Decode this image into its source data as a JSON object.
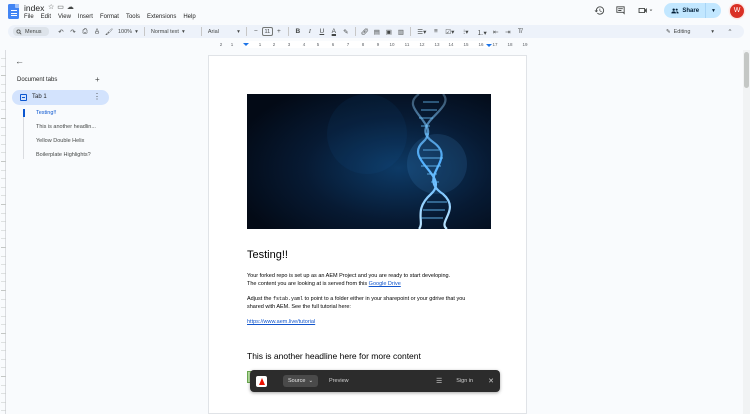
{
  "app": {
    "doc_title": "index",
    "menu": [
      "File",
      "Edit",
      "View",
      "Insert",
      "Format",
      "Tools",
      "Extensions",
      "Help"
    ]
  },
  "header": {
    "share_label": "Share",
    "avatar_letter": "W"
  },
  "toolbar": {
    "menus_label": "Menus",
    "zoom": "100%",
    "style": "Normal text",
    "font": "Arial",
    "font_size": "11",
    "mode": "Editing"
  },
  "ruler": {
    "ticks": [
      "2",
      "1",
      "1",
      "2",
      "3",
      "4",
      "5",
      "6",
      "7",
      "8",
      "9",
      "10",
      "11",
      "12",
      "13",
      "14",
      "15",
      "16",
      "17",
      "18",
      "19"
    ]
  },
  "sidebar": {
    "header": "Document tabs",
    "tab_label": "Tab 1",
    "outline": [
      "Testing!!",
      "This is another headlin...",
      "Yellow Double Helix",
      "Boilerplate Highlights?"
    ]
  },
  "document": {
    "heading1": "Testing!!",
    "para1_line1": "Your forked repo is set up as an AEM Project and you are ready to start developing.",
    "para1_line2_prefix": "The content you are looking at is served from this ",
    "para1_link": "Google Drive",
    "para2_prefix": "Adjust the ",
    "para2_code": "fstab.yaml",
    "para2_suffix": " to point to a folder either in your sharepoint or your gdrive that you",
    "para2_line2": "shared with AEM. See the full tutorial here:",
    "tutorial_link": "https://www.aem.live/tutorial",
    "heading2": "This is another headline here for more content"
  },
  "floatbar": {
    "source_label": "Source",
    "preview_label": "Preview",
    "signin_label": "Sign in"
  },
  "colors": {
    "accent": "#0b57d0",
    "share_bg": "#c2e7ff",
    "avatar_bg": "#d93025",
    "floatbar_bg": "#2c2c2c"
  }
}
